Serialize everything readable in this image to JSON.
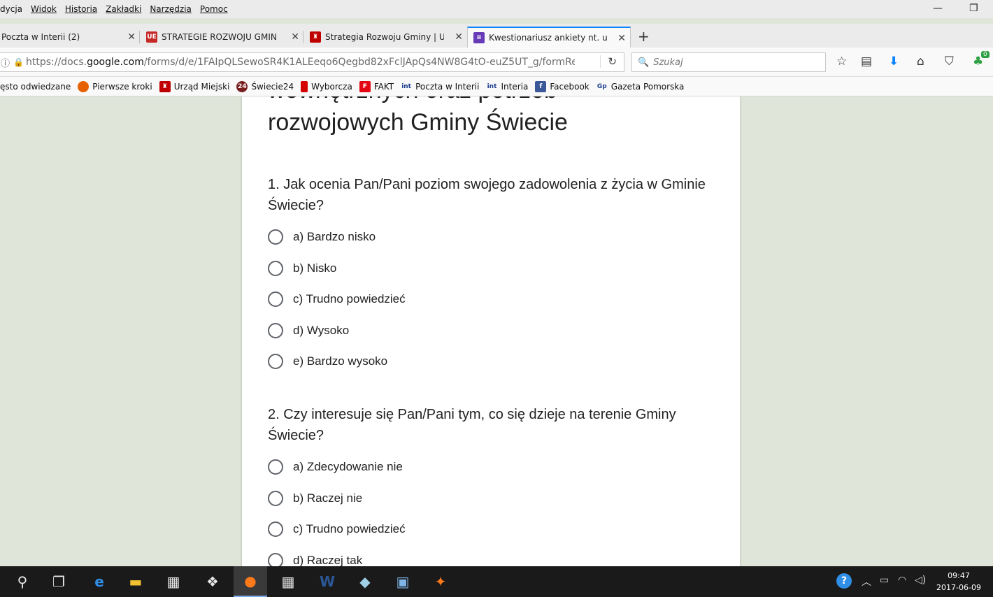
{
  "menu": {
    "items": [
      "dycja",
      "Widok",
      "Historia",
      "Zakładki",
      "Narzędzia",
      "Pomoc"
    ]
  },
  "tabs": [
    {
      "title": "Poczta w Interii (2)",
      "icon": "interia-icon",
      "active": false
    },
    {
      "title": "STRATEGIE ROZWOJU GMIN",
      "icon": "ue-flag-icon",
      "active": false
    },
    {
      "title": "Strategia Rozwoju Gminy | U",
      "icon": "coat-of-arms-icon",
      "active": false
    },
    {
      "title": "Kwestionariusz ankiety nt. u",
      "icon": "google-forms-icon",
      "active": true
    }
  ],
  "address_bar": {
    "url_prefix": "https://docs.",
    "url_domain": "google.com",
    "url_rest": "/forms/d/e/1FAIpQLSewoSR4K1ALEeqo6Qegbd82xFclJApQs4NW8G4tO-euZ5UT_g/formRe"
  },
  "search": {
    "placeholder": "Szukaj"
  },
  "bookmarks": [
    {
      "label": "ęsto odwiedzane",
      "icon": "",
      "color": ""
    },
    {
      "label": "Pierwsze kroki",
      "icon": "firefox-icon",
      "color": "#e66000"
    },
    {
      "label": "Urząd Miejski",
      "icon": "coat-of-arms-icon",
      "color": "#c00000"
    },
    {
      "label": "Świecie24",
      "icon": "swiecie24-icon",
      "color": "#7a1f1f"
    },
    {
      "label": "Wyborcza",
      "icon": "wyborcza-icon",
      "color": "#d40000"
    },
    {
      "label": "FAKT",
      "icon": "fakt-icon",
      "color": "#e30613"
    },
    {
      "label": "Poczta w Interii",
      "icon": "interia-icon",
      "color": "#1b3c8c"
    },
    {
      "label": "Interia",
      "icon": "interia-icon",
      "color": "#1b3c8c"
    },
    {
      "label": "Facebook",
      "icon": "facebook-icon",
      "color": "#3b5998"
    },
    {
      "label": "Gazeta Pomorska",
      "icon": "gazeta-pomorska-icon",
      "color": "#1e3f8f"
    }
  ],
  "form": {
    "title_line1": "wewnętrznych oraz potrzeb",
    "title_line2": "rozwojowych Gminy Świecie",
    "questions": [
      {
        "text": "1. Jak ocenia Pan/Pani poziom swojego zadowolenia z życia w Gminie Świecie?",
        "options": [
          "a) Bardzo nisko",
          "b) Nisko",
          "c) Trudno powiedzieć",
          "d) Wysoko",
          "e) Bardzo wysoko"
        ]
      },
      {
        "text": "2. Czy interesuje się Pan/Pani tym, co się dzieje na terenie Gminy Świecie?",
        "options": [
          "a) Zdecydowanie nie",
          "b) Raczej nie",
          "c) Trudno powiedzieć",
          "d) Raczej tak"
        ]
      }
    ]
  },
  "taskbar": {
    "clock_time": "09:47",
    "clock_date": "2017-06-09",
    "downloads_badge": "0"
  },
  "colors": {
    "page_background": "#dfe6d9",
    "forms_accent": "#673ab7",
    "tab_active_accent": "#0a84ff",
    "taskbar": "#1a1a1a"
  }
}
